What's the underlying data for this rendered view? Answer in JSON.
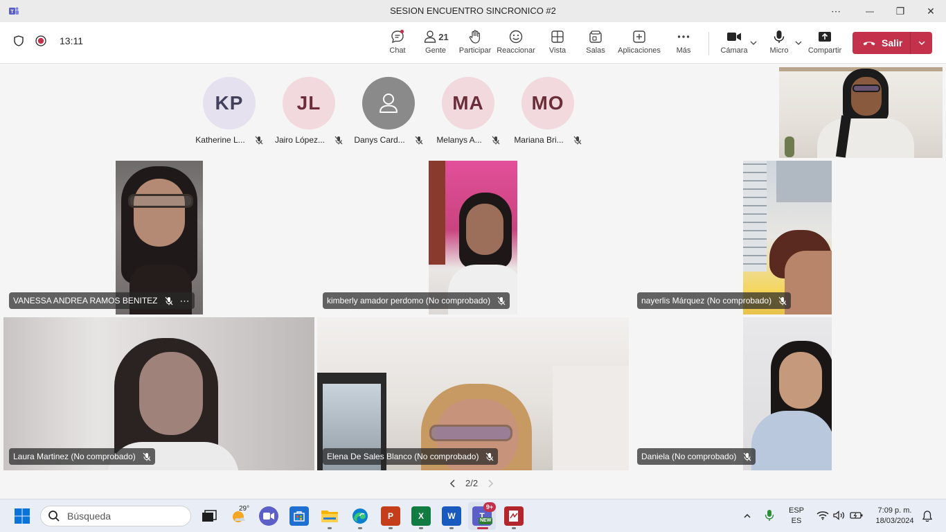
{
  "window": {
    "title": "SESION ENCUENTRO SINCRONICO #2",
    "more_glyph": "⋯",
    "minimize_glyph": "—",
    "restore_glyph": "❐",
    "close_glyph": "✕"
  },
  "meeting_bar": {
    "timer": "13:11",
    "buttons": [
      {
        "label": "Chat",
        "icon": "chat-icon"
      },
      {
        "label": "Gente",
        "icon": "people-icon",
        "count": "21"
      },
      {
        "label": "Participar",
        "icon": "raise-hand-icon"
      },
      {
        "label": "Reaccionar",
        "icon": "smiley-icon"
      },
      {
        "label": "Vista",
        "icon": "grid-view-icon"
      },
      {
        "label": "Salas",
        "icon": "breakout-rooms-icon"
      },
      {
        "label": "Aplicaciones",
        "icon": "add-app-icon"
      },
      {
        "label": "Más",
        "icon": "more-icon"
      },
      {
        "label": "Cámara",
        "icon": "camera-icon"
      },
      {
        "label": "Micro",
        "icon": "microphone-icon"
      },
      {
        "label": "Compartir",
        "icon": "share-icon"
      }
    ],
    "leave_label": "Salir",
    "accent_leave": "#c4314b"
  },
  "avatars": [
    {
      "initials": "KP",
      "name": "Katherine L...",
      "bg": "#e6e1ef",
      "fg": "#43405c"
    },
    {
      "initials": "JL",
      "name": "Jairo López...",
      "bg": "#f1d9dd",
      "fg": "#6b2e38"
    },
    {
      "initials": "",
      "name": "Danys Card...",
      "bg": "#8a8a8a",
      "fg": "#ffffff"
    },
    {
      "initials": "MA",
      "name": "Melanys A...",
      "bg": "#f1d9dd",
      "fg": "#6b2e38"
    },
    {
      "initials": "MO",
      "name": "Mariana Bri...",
      "bg": "#f1d9dd",
      "fg": "#6b2e38"
    }
  ],
  "video_tiles": [
    {
      "name": "VANESSA ANDREA RAMOS BENITEZ",
      "has_more": true
    },
    {
      "name": "kimberly amador perdomo (No comprobado)"
    },
    {
      "name": "nayerlis Márquez (No comprobado)"
    },
    {
      "name": "Laura Martinez (No comprobado)"
    },
    {
      "name": "Elena De Sales Blanco (No comprobado)"
    },
    {
      "name": "Daniela (No comprobado)"
    }
  ],
  "pager": {
    "text": "2/2"
  },
  "taskbar": {
    "search_placeholder": "Búsqueda",
    "weather_temp": "29°",
    "teams_badge": "9+",
    "teams_new": "NEW",
    "apps": [
      "start-icon",
      "task-view-icon",
      "weather-icon",
      "meet-icon",
      "store-icon",
      "file-explorer-icon",
      "edge-icon",
      "powerpoint-icon",
      "excel-icon",
      "word-icon",
      "teams-icon",
      "pdf-icon"
    ],
    "lang_top": "ESP",
    "lang_bottom": "ES",
    "time": "7:09 p. m.",
    "date": "18/03/2024"
  }
}
